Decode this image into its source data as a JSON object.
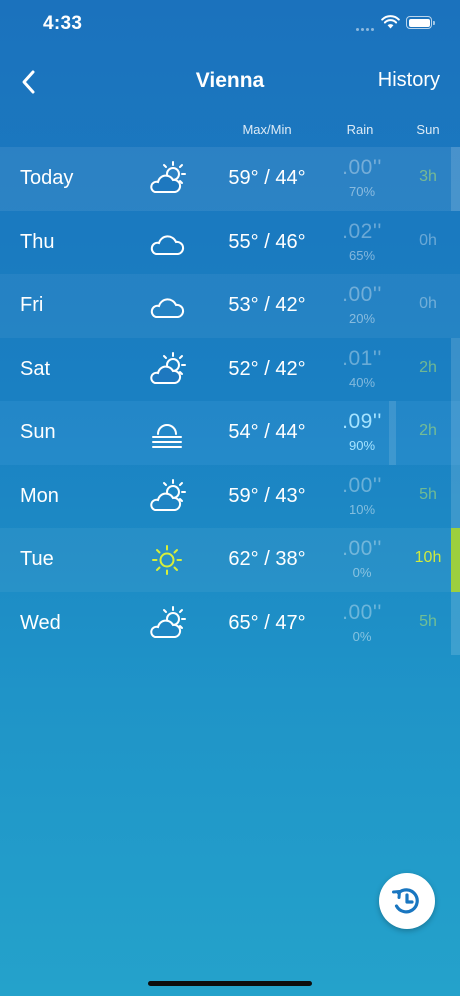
{
  "status_bar": {
    "time": "4:33"
  },
  "nav": {
    "title": "Vienna",
    "history_label": "History"
  },
  "columns": {
    "maxmin": "Max/Min",
    "rain": "Rain",
    "sun": "Sun"
  },
  "days": [
    {
      "name": "Today",
      "icon": "partly-cloudy-icon",
      "temps": "59° / 44°",
      "rain": ".00''",
      "chance": "70%",
      "sun": "3h"
    },
    {
      "name": "Thu",
      "icon": "cloud-icon",
      "temps": "55° / 46°",
      "rain": ".02''",
      "chance": "65%",
      "sun": "0h"
    },
    {
      "name": "Fri",
      "icon": "cloud-icon",
      "temps": "53° / 42°",
      "rain": ".00''",
      "chance": "20%",
      "sun": "0h"
    },
    {
      "name": "Sat",
      "icon": "partly-cloudy-icon",
      "temps": "52° / 42°",
      "rain": ".01''",
      "chance": "40%",
      "sun": "2h"
    },
    {
      "name": "Sun",
      "icon": "fog-icon",
      "temps": "54° / 44°",
      "rain": ".09''",
      "chance": "90%",
      "sun": "2h"
    },
    {
      "name": "Mon",
      "icon": "partly-cloudy-icon",
      "temps": "59° / 43°",
      "rain": ".00''",
      "chance": "10%",
      "sun": "5h"
    },
    {
      "name": "Tue",
      "icon": "sun-icon",
      "temps": "62° / 38°",
      "rain": ".00''",
      "chance": "0%",
      "sun": "10h"
    },
    {
      "name": "Wed",
      "icon": "partly-cloudy-icon",
      "temps": "65° / 47°",
      "rain": ".00''",
      "chance": "0%",
      "sun": "5h"
    }
  ],
  "colors": {
    "accent_sun": "#cfe93f",
    "accent_rain": "#a5e3ff",
    "background_top": "#1b72bd",
    "background_bottom": "#24a2cb"
  }
}
